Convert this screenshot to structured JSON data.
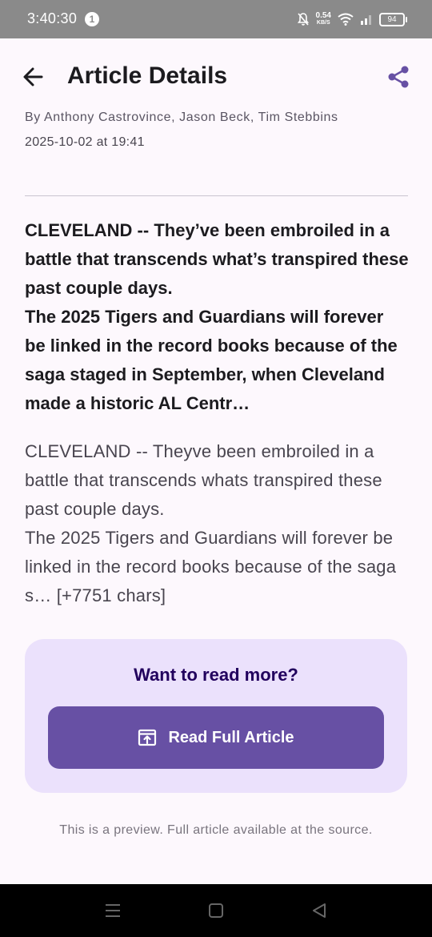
{
  "status_bar": {
    "time": "3:40:30",
    "notification_count": "1",
    "net_speed_value": "0.54",
    "net_speed_unit": "KB/S",
    "battery": "94"
  },
  "app_bar": {
    "title": "Article Details",
    "back_icon": "arrow-back-icon",
    "share_icon": "share-icon"
  },
  "article": {
    "byline": "By Anthony Castrovince, Jason Beck, Tim Stebbins",
    "date": "2025-10-02 at 19:41",
    "summary_p1": "CLEVELAND -- They’ve been embroiled in a battle that transcends what’s transpired these past couple days.",
    "summary_p2": "The 2025 Tigers and Guardians will forever be linked in the record books because of the saga staged in September, when Cleveland made a historic AL Centr…",
    "content_p1": "CLEVELAND -- Theyve been embroiled in a battle that transcends whats transpired these past couple days.",
    "content_p2": "The 2025 Tigers and Guardians will forever be linked in the record books because of the saga s… [+7751 chars]"
  },
  "cta": {
    "heading": "Want to read more?",
    "button_label": "Read Full Article",
    "button_icon": "open-in-new-icon"
  },
  "footer_note": "This is a preview. Full article available at the source.",
  "colors": {
    "primary": "#6750a4",
    "card_background": "#ebe1fc",
    "page_background": "#fdf8fd"
  },
  "nav_bar": {
    "icons": [
      "menu-icon",
      "home-square-icon",
      "back-triangle-icon"
    ]
  }
}
